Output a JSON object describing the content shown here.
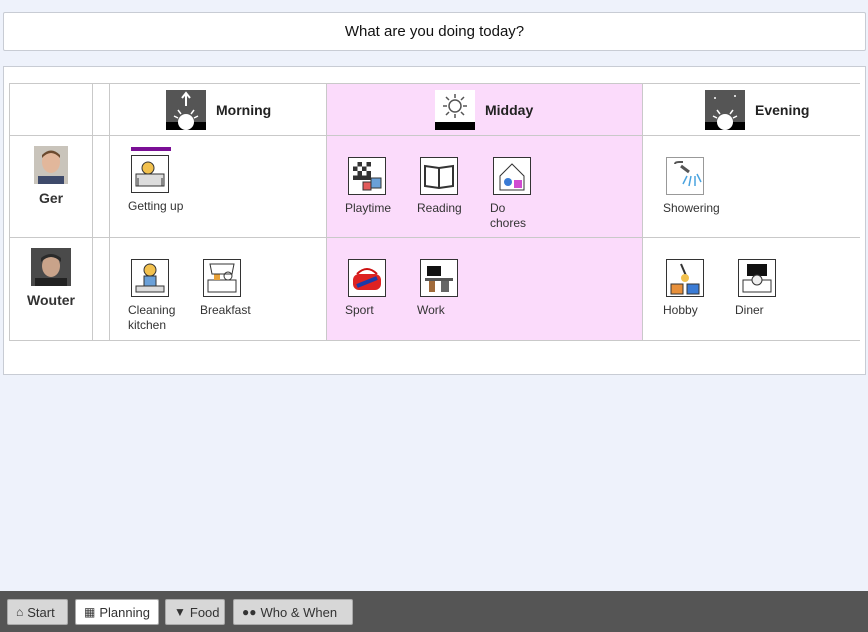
{
  "question": "What are you doing today?",
  "columns": {
    "morning": "Morning",
    "midday": "Midday",
    "evening": "Evening"
  },
  "people": [
    {
      "name": "Ger",
      "morning": [
        "Getting up"
      ],
      "midday": [
        "Playtime",
        "Reading",
        "Do chores"
      ],
      "evening": [
        "Showering"
      ]
    },
    {
      "name": "Wouter",
      "morning": [
        "Cleaning kitchen",
        "Breakfast"
      ],
      "midday": [
        "Sport",
        "Work"
      ],
      "evening": [
        "Hobby",
        "Diner"
      ]
    }
  ],
  "nav": {
    "start": "Start",
    "planning": "Planning",
    "food": "Food",
    "who_when": "Who & When"
  },
  "colors": {
    "highlight_column": "#fbdbfb",
    "selection_bar": "#7a0f95",
    "page_background": "#eef2fb"
  }
}
